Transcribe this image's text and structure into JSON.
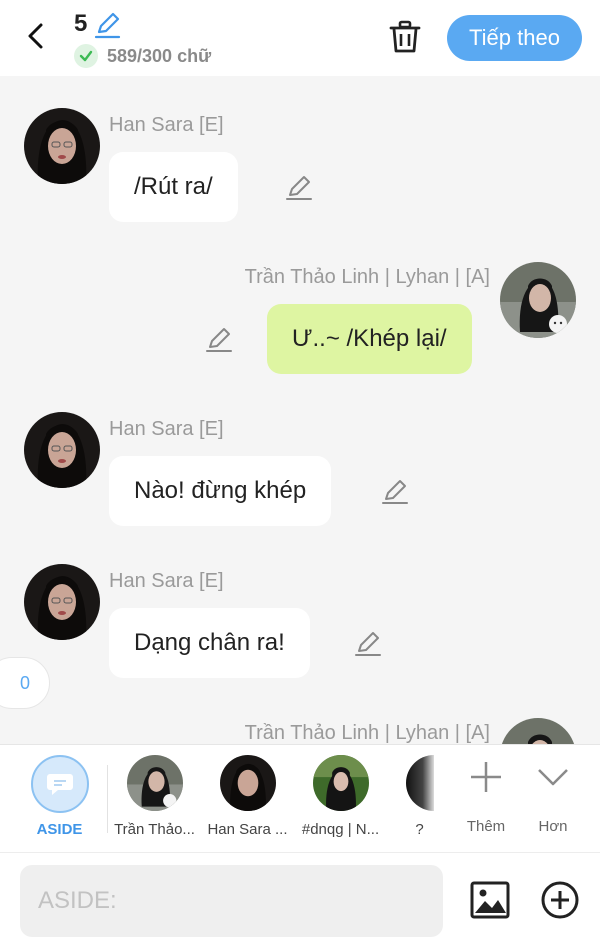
{
  "header": {
    "back_icon": "chevron-left-icon",
    "title_number": "5",
    "edit_icon": "pencil-icon",
    "word_count": "589/300 chữ",
    "check_icon": "check-icon",
    "trash_icon": "trash-icon",
    "next_label": "Tiếp theo"
  },
  "messages": [
    {
      "side": "left",
      "sender": "Han Sara [E]",
      "text": "/Rút ra/"
    },
    {
      "side": "right",
      "sender": "Trần Thảo Linh | Lyhan | [A]",
      "text": "Ư..~ /Khép lại/"
    },
    {
      "side": "left",
      "sender": "Han Sara [E]",
      "text": "Nào! đừng khép"
    },
    {
      "side": "left",
      "sender": "Han Sara [E]",
      "text": "Dạng chân ra!"
    },
    {
      "side": "right",
      "sender": "Trần Thảo Linh | Lyhan | [A]",
      "text": ""
    }
  ],
  "side_counter": "0",
  "characters": [
    {
      "label": "ASIDE",
      "icon": "aside-icon"
    },
    {
      "label": "Trần Thảo..."
    },
    {
      "label": "Han Sara ..."
    },
    {
      "label": "#dnqg | N..."
    },
    {
      "label": "?"
    }
  ],
  "tools": [
    {
      "label": "Thêm",
      "icon": "plus-icon"
    },
    {
      "label": "Hơn",
      "icon": "chevron-down-icon"
    }
  ],
  "composer": {
    "placeholder": "ASIDE:",
    "value": "",
    "image_icon": "image-icon",
    "add_icon": "add-circle-icon"
  },
  "colors": {
    "accent": "#5aa9f2",
    "right_bubble": "#def5a2",
    "left_bubble": "#ffffff",
    "background": "#f5f5f5"
  }
}
